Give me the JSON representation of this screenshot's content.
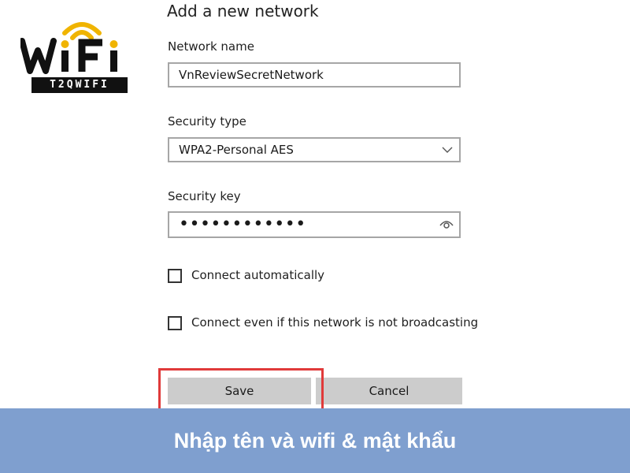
{
  "logo": {
    "word": "WiFi",
    "banner": "T2QWIFI",
    "colors": {
      "primary": "#111111",
      "accent": "#f0b400"
    }
  },
  "dialog": {
    "title": "Add a new network",
    "network_name": {
      "label": "Network name",
      "value": "VnReviewSecretNetwork"
    },
    "security_type": {
      "label": "Security type",
      "value": "WPA2-Personal AES",
      "icon": "chevron-down-icon"
    },
    "security_key": {
      "label": "Security key",
      "value": "••••••••••••",
      "icon": "eye-icon"
    },
    "checkboxes": [
      {
        "label": "Connect automatically",
        "checked": false
      },
      {
        "label": "Connect even if this network is not broadcasting",
        "checked": false
      }
    ],
    "buttons": {
      "save": "Save",
      "cancel": "Cancel"
    },
    "highlight_color": "#e03a3a"
  },
  "caption": {
    "text": "Nhập tên và wifi & mật khẩu",
    "background": "#7f9fcf"
  }
}
